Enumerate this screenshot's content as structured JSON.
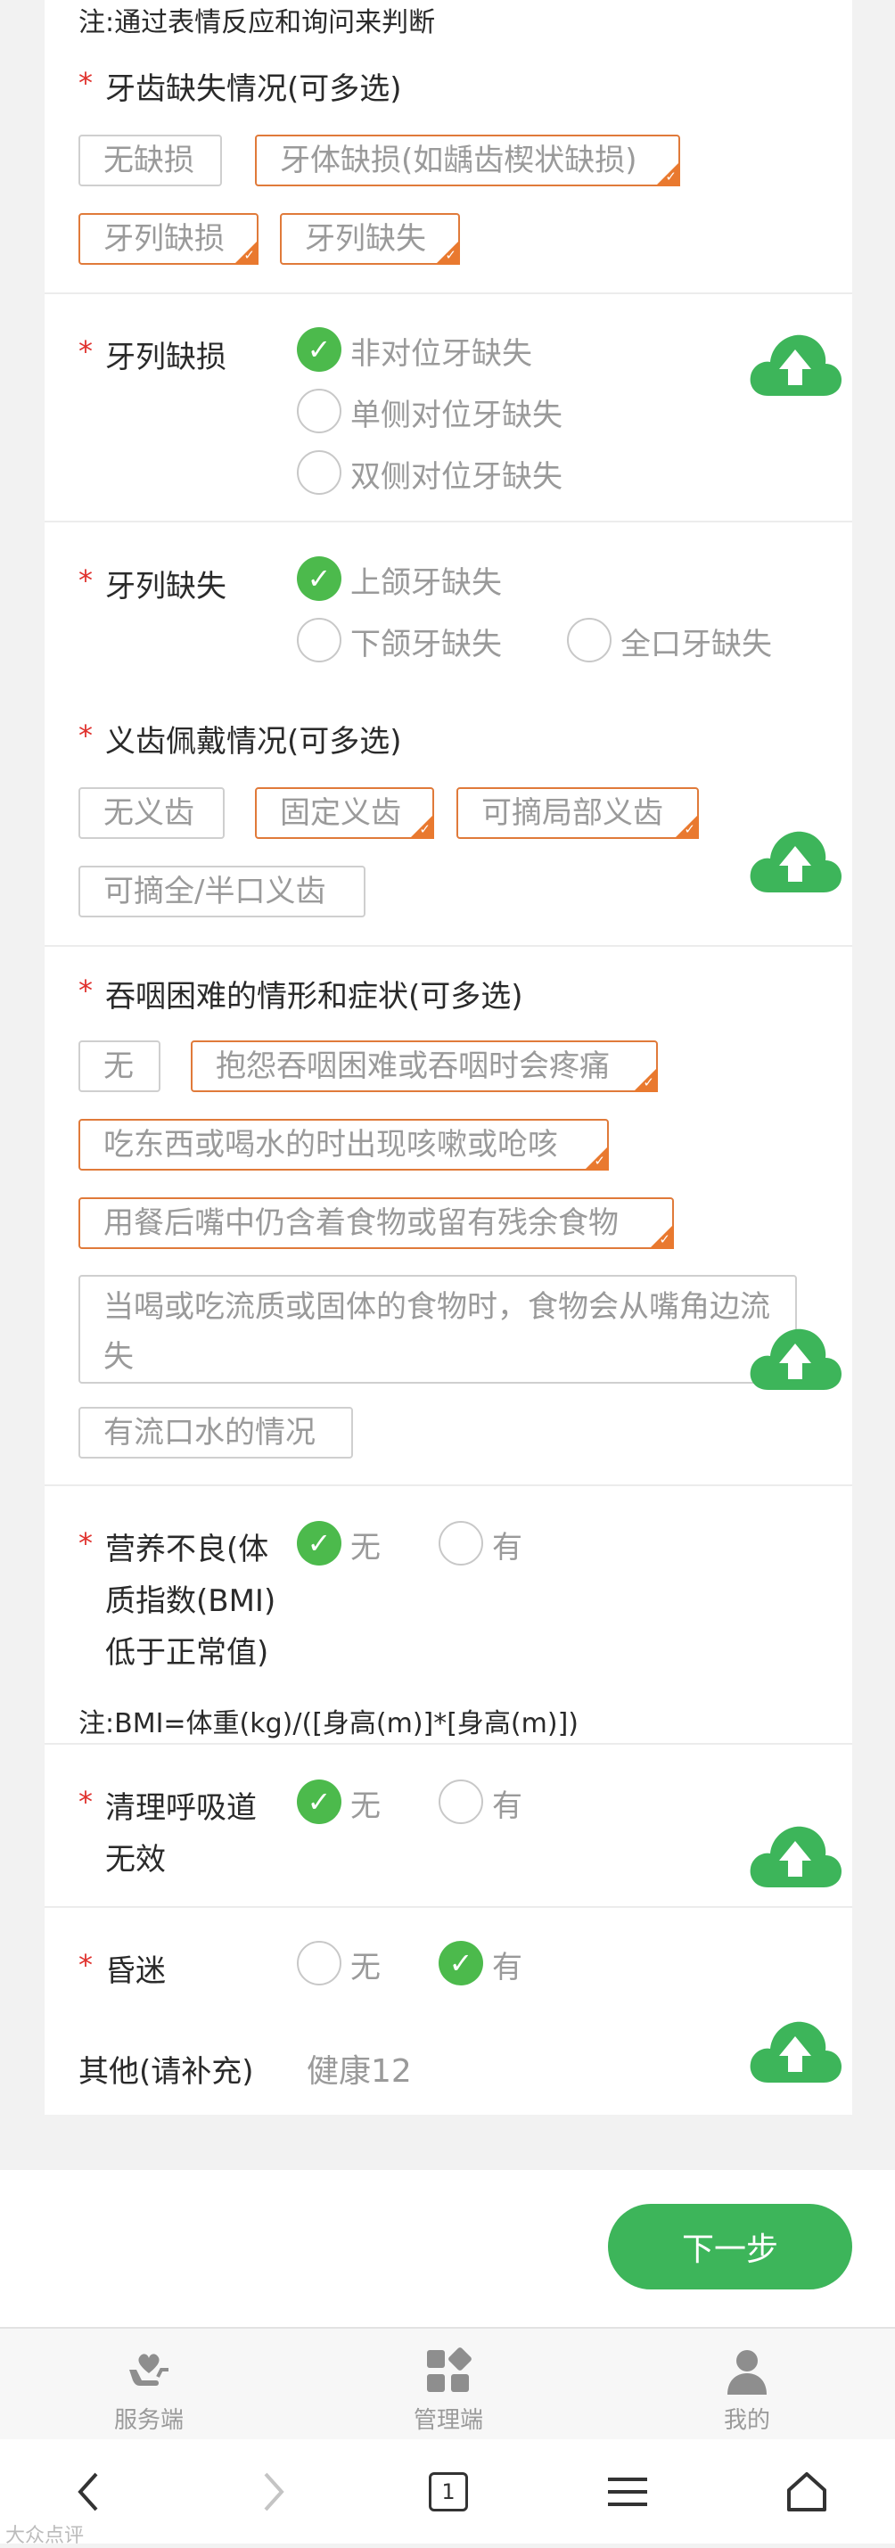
{
  "top_note": "注:通过表情反应和询问来判断",
  "req_mark": "*",
  "q_missing": {
    "label": "牙齿缺失情况(可多选)",
    "tags": [
      "无缺损",
      "牙体缺损(如龋齿楔状缺损)",
      "牙列缺损",
      "牙列缺失"
    ]
  },
  "q_defect": {
    "label": "牙列缺损",
    "options": [
      "非对位牙缺失",
      "单侧对位牙缺失",
      "双侧对位牙缺失"
    ]
  },
  "q_loss": {
    "label": "牙列缺失",
    "options": [
      "上颌牙缺失",
      "下颌牙缺失",
      "全口牙缺失"
    ]
  },
  "q_denture": {
    "label": "义齿佩戴情况(可多选)",
    "tags": [
      "无义齿",
      "固定义齿",
      "可摘局部义齿",
      "可摘全/半口义齿"
    ]
  },
  "q_swallow": {
    "label": "吞咽困难的情形和症状(可多选)",
    "tags": [
      "无",
      "抱怨吞咽困难或吞咽时会疼痛",
      "吃东西或喝水的时出现咳嗽或呛咳",
      "用餐后嘴中仍含着食物或留有残余食物",
      "当喝或吃流质或固体的食物时，食物会从嘴角边流失",
      "有流口水的情况"
    ]
  },
  "q_nutrition": {
    "label_lines": [
      "营养不良(体",
      "质指数(BMI)",
      "低于正常值)"
    ],
    "options": [
      "无",
      "有"
    ],
    "note": "注:BMI=体重(kg)/([身高(m)]*[身高(m)])"
  },
  "q_airway": {
    "label_lines": [
      "清理呼吸道",
      "无效"
    ],
    "options": [
      "无",
      "有"
    ]
  },
  "q_coma": {
    "label": "昏迷",
    "options": [
      "无",
      "有"
    ]
  },
  "other": {
    "label": "其他(请补充)",
    "value": "健康12"
  },
  "next_button": "下一步",
  "tabs": [
    {
      "label": "服务端",
      "icon": "heart-hand-icon"
    },
    {
      "label": "管理端",
      "icon": "grid-icon"
    },
    {
      "label": "我的",
      "icon": "person-icon"
    }
  ],
  "nav": {
    "page_count": "1"
  },
  "watermark": "大众点评",
  "colors": {
    "accent_green": "#4cba4c",
    "selected_orange": "#e9792f",
    "required_red": "#e0312d"
  }
}
